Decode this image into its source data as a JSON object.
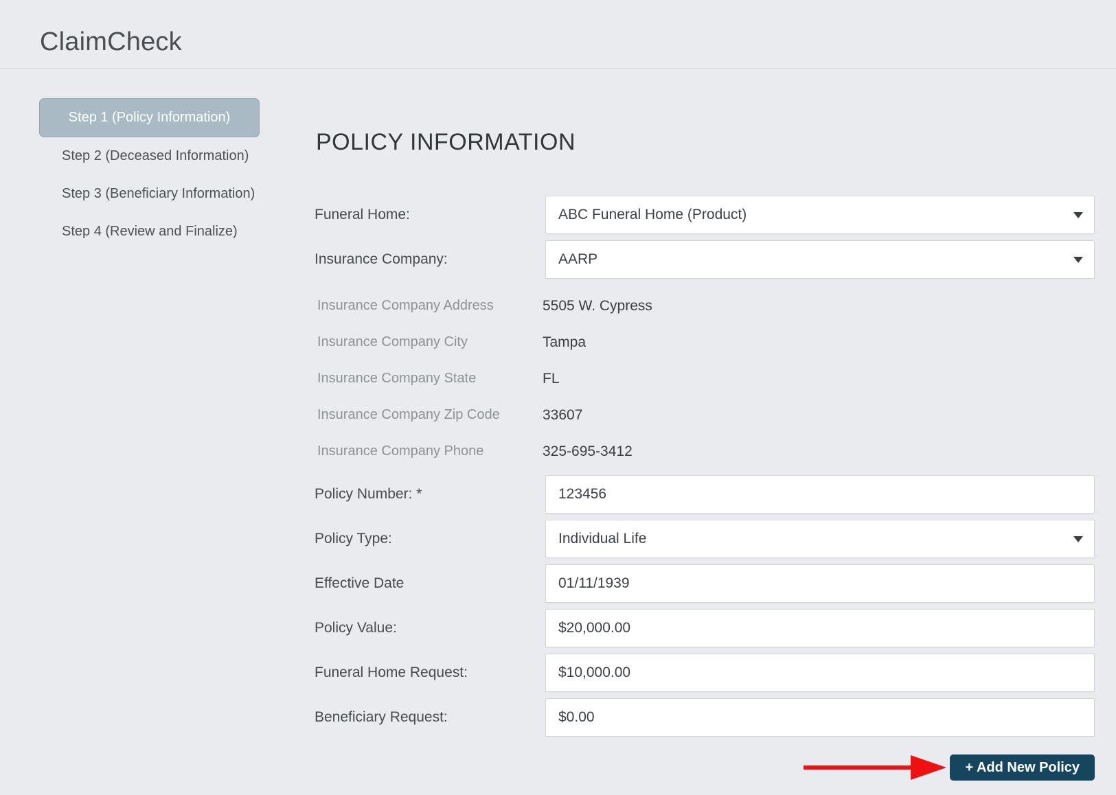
{
  "app": {
    "title": "ClaimCheck"
  },
  "sidebar": {
    "steps": [
      {
        "label": "Step 1 (Policy Information)",
        "active": true
      },
      {
        "label": "Step 2 (Deceased Information)",
        "active": false
      },
      {
        "label": "Step 3 (Beneficiary Information)",
        "active": false
      },
      {
        "label": "Step 4 (Review and Finalize)",
        "active": false
      }
    ]
  },
  "main": {
    "heading": "POLICY INFORMATION",
    "fields": {
      "funeral_home": {
        "label": "Funeral Home:",
        "value": "ABC Funeral Home (Product)"
      },
      "insurance_company": {
        "label": "Insurance Company:",
        "value": "AARP"
      },
      "insurance_company_address": {
        "label": "Insurance Company Address",
        "value": "5505 W. Cypress"
      },
      "insurance_company_city": {
        "label": "Insurance Company City",
        "value": "Tampa"
      },
      "insurance_company_state": {
        "label": "Insurance Company State",
        "value": "FL"
      },
      "insurance_company_zip": {
        "label": "Insurance Company Zip Code",
        "value": "33607"
      },
      "insurance_company_phone": {
        "label": "Insurance Company Phone",
        "value": "325-695-3412"
      },
      "policy_number": {
        "label": "Policy Number: *",
        "value": "123456"
      },
      "policy_type": {
        "label": "Policy Type:",
        "value": "Individual Life"
      },
      "effective_date": {
        "label": "Effective Date",
        "value": "01/11/1939"
      },
      "policy_value": {
        "label": "Policy Value:",
        "value": "$20,000.00"
      },
      "funeral_home_request": {
        "label": "Funeral Home Request:",
        "value": "$10,000.00"
      },
      "beneficiary_request": {
        "label": "Beneficiary Request:",
        "value": "$0.00"
      }
    }
  },
  "footer": {
    "add_button_label": "+ Add New Policy"
  },
  "colors": {
    "page_background": "#e9ebee",
    "active_step_background": "#a9bac4",
    "button_navy": "#16455f",
    "annotation_red": "#ef1010"
  }
}
